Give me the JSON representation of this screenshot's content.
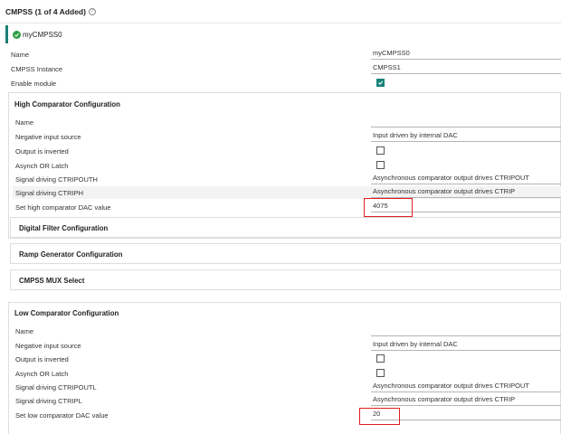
{
  "header": {
    "title": "CMPSS (1 of 4 Added)",
    "help_icon": "question-circle-icon"
  },
  "instance": {
    "name": "myCMPSS0",
    "status_icon": "check-circle-icon",
    "accent": "#1a7f75"
  },
  "general": {
    "name_label": "Name",
    "name_value": "myCMPSS0",
    "instance_label": "CMPSS Instance",
    "instance_value": "CMPSS1",
    "enable_label": "Enable module",
    "enable_checked": true
  },
  "high": {
    "title": "High Comparator Configuration",
    "name_label": "Name",
    "name_value": "",
    "neg_label": "Negative input source",
    "neg_value": "Input driven by internal DAC",
    "inverted_label": "Output is inverted",
    "inverted_checked": false,
    "asynch_label": "Asynch OR Latch",
    "asynch_checked": false,
    "tripout_label": "Signal driving CTRIPOUTH",
    "tripout_value": "Asynchronous comparator output drives CTRIPOUT",
    "trip_label": "Signal driving CTRIPH",
    "trip_value": "Asynchronous comparator output drives CTRIP",
    "dac_label": "Set high comparator DAC value",
    "dac_value": "4075"
  },
  "subsections": {
    "digital_filter": "Digital Filter Configuration",
    "ramp_generator": "Ramp Generator Configuration",
    "mux_select": "CMPSS MUX Select"
  },
  "low": {
    "title": "Low Comparator Configuration",
    "name_label": "Name",
    "name_value": "",
    "neg_label": "Negative input source",
    "neg_value": "Input driven by internal DAC",
    "inverted_label": "Output is inverted",
    "inverted_checked": false,
    "asynch_label": "Asynch OR Latch",
    "asynch_checked": false,
    "tripout_label": "Signal driving CTRIPOUTL",
    "tripout_value": "Asynchronous comparator output drives CTRIPOUT",
    "trip_label": "Signal driving CTRIPL",
    "trip_value": "Asynchronous comparator output drives CTRIP",
    "dac_label": "Set low comparator DAC value",
    "dac_value": "20"
  },
  "colors": {
    "highlight_box": "#e02020",
    "checkbox_checked": "#17837a"
  }
}
